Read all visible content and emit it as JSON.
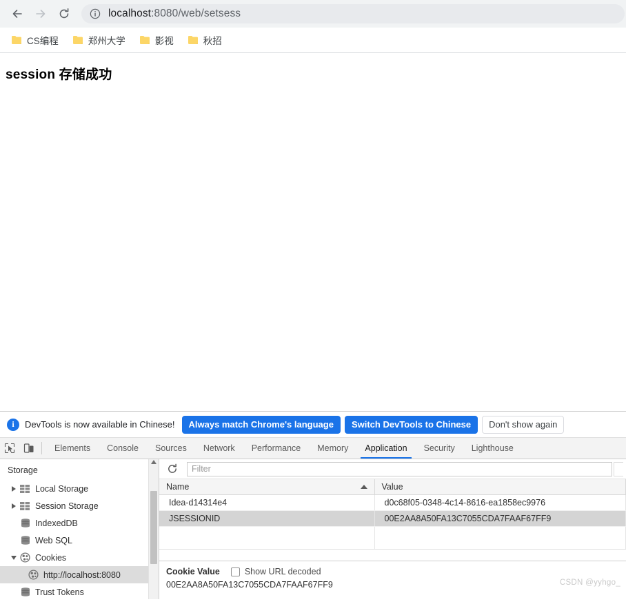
{
  "browser": {
    "nav": {
      "back_label": "Back",
      "forward_label": "Forward",
      "reload_label": "Reload"
    },
    "omnibox": {
      "host": "localhost",
      "path": ":8080/web/setsess",
      "site_info_label": "View site information"
    },
    "bookmarks": [
      {
        "label": "CS编程"
      },
      {
        "label": "郑州大学"
      },
      {
        "label": "影视"
      },
      {
        "label": "秋招"
      }
    ]
  },
  "page": {
    "heading": "session 存储成功"
  },
  "devtools": {
    "banner": {
      "icon": "info-icon",
      "message": "DevTools is now available in Chinese!",
      "primary_button": "Always match Chrome's language",
      "secondary_button": "Switch DevTools to Chinese",
      "dismiss_button": "Don't show again"
    },
    "toolbar": {
      "inspect_label": "Inspect element",
      "device_label": "Toggle device toolbar"
    },
    "tabs": [
      {
        "label": "Elements",
        "active": false
      },
      {
        "label": "Console",
        "active": false
      },
      {
        "label": "Sources",
        "active": false
      },
      {
        "label": "Network",
        "active": false
      },
      {
        "label": "Performance",
        "active": false
      },
      {
        "label": "Memory",
        "active": false
      },
      {
        "label": "Application",
        "active": true
      },
      {
        "label": "Security",
        "active": false
      },
      {
        "label": "Lighthouse",
        "active": false
      }
    ],
    "sidebar": {
      "title": "Storage",
      "items": [
        {
          "label": "Local Storage",
          "icon": "table-icon",
          "twisty": "collapsed",
          "indent": 1,
          "selected": false
        },
        {
          "label": "Session Storage",
          "icon": "table-icon",
          "twisty": "collapsed",
          "indent": 1,
          "selected": false
        },
        {
          "label": "IndexedDB",
          "icon": "database-icon",
          "twisty": "none",
          "indent": 1,
          "selected": false
        },
        {
          "label": "Web SQL",
          "icon": "database-icon",
          "twisty": "none",
          "indent": 1,
          "selected": false
        },
        {
          "label": "Cookies",
          "icon": "cookie-icon",
          "twisty": "expanded",
          "indent": 1,
          "selected": false
        },
        {
          "label": "http://localhost:8080",
          "icon": "cookie-icon",
          "twisty": "none",
          "indent": 2,
          "selected": true
        },
        {
          "label": "Trust Tokens",
          "icon": "database-icon",
          "twisty": "none",
          "indent": 1,
          "selected": false
        }
      ]
    },
    "cookie_panel": {
      "refresh_label": "Refresh",
      "filter_placeholder": "Filter",
      "filter_value": "",
      "columns": [
        {
          "label": "Name",
          "sorted": "asc"
        },
        {
          "label": "Value",
          "sorted": "none"
        }
      ],
      "rows": [
        {
          "name": "Idea-d14314e4",
          "value": "d0c68f05-0348-4c14-8616-ea1858ec9976",
          "selected": false
        },
        {
          "name": "JSESSIONID",
          "value": "00E2AA8A50FA13C7055CDA7FAAF67FF9",
          "selected": true
        }
      ],
      "detail": {
        "title": "Cookie Value",
        "checkbox_label": "Show URL decoded",
        "checkbox_checked": false,
        "value": "00E2AA8A50FA13C7055CDA7FAAF67FF9"
      }
    }
  },
  "watermark": "CSDN @yyhgo_"
}
